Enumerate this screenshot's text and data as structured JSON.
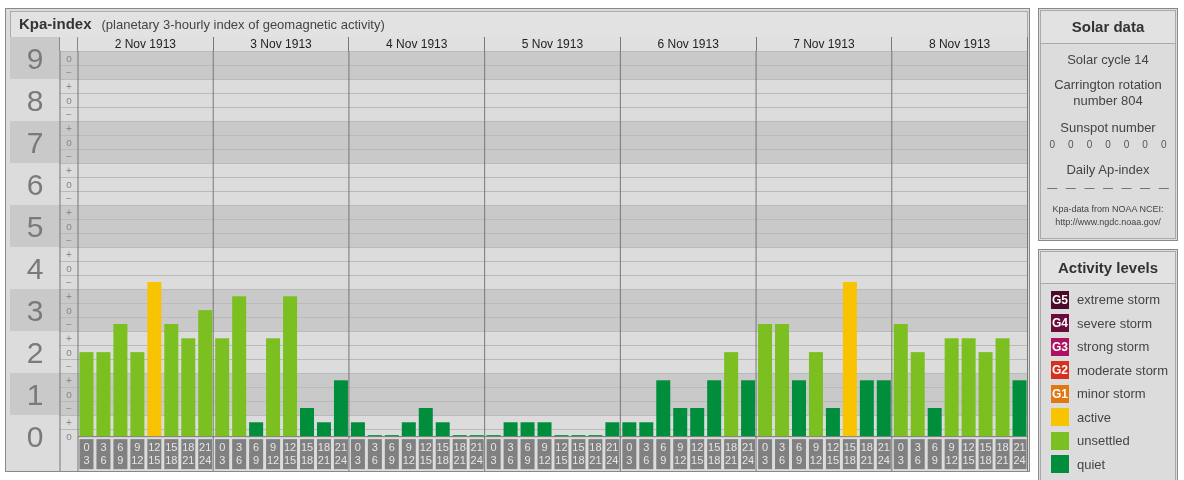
{
  "kpa": {
    "title": "Kpa-index",
    "subtitle": "(planetary 3-hourly index of geomagnetic activity)",
    "days": [
      "2 Nov 1913",
      "3 Nov 1913",
      "4 Nov 1913",
      "5 Nov 1913",
      "6 Nov 1913",
      "7 Nov 1913",
      "8 Nov 1913"
    ],
    "minor_labels": [
      "o",
      "−",
      "+",
      "o",
      "−",
      "+",
      "o",
      "−",
      "+",
      "o",
      "−",
      "+",
      "o",
      "−",
      "+",
      "o",
      "−",
      "+",
      "o",
      "−",
      "+",
      "o",
      "−",
      "+",
      "o",
      "−",
      "+",
      "o"
    ],
    "chart_data": {
      "type": "bar",
      "stacked": true,
      "grid": true,
      "ylim": [
        0,
        9.17
      ],
      "yticks": [
        {
          "value": 0,
          "label": "0"
        },
        {
          "value": 1,
          "label": "1"
        },
        {
          "value": 2,
          "label": "2"
        },
        {
          "value": 3,
          "label": "3"
        },
        {
          "value": 4,
          "label": "4"
        },
        {
          "value": 5,
          "label": "5"
        },
        {
          "value": 6,
          "label": "6"
        },
        {
          "value": 7,
          "label": "7"
        },
        {
          "value": 8,
          "label": "8"
        },
        {
          "value": 9,
          "label": "9"
        }
      ],
      "categories": [
        "0 3",
        "3 6",
        "6 9",
        "9 12",
        "12 15",
        "15 18",
        "18 21",
        "21 24",
        "0 3",
        "3 6",
        "6 9",
        "9 12",
        "12 15",
        "15 18",
        "18 21",
        "21 24",
        "0 3",
        "3 6",
        "6 9",
        "9 12",
        "12 15",
        "15 18",
        "18 21",
        "21 24",
        "0 3",
        "3 6",
        "6 9",
        "9 12",
        "12 15",
        "15 18",
        "18 21",
        "21 24",
        "0 3",
        "3 6",
        "6 9",
        "9 12",
        "12 15",
        "15 18",
        "18 21",
        "21 24",
        "0 3",
        "3 6",
        "6 9",
        "9 12",
        "12 15",
        "15 18",
        "18 21",
        "21 24",
        "0 3",
        "3 6",
        "6 9",
        "9 12",
        "12 15",
        "15 18",
        "18 21",
        "21 24"
      ],
      "series": [
        {
          "name": "quiet",
          "color": "#008e3d",
          "values": [
            null,
            null,
            null,
            null,
            null,
            null,
            null,
            null,
            null,
            null,
            0.33,
            null,
            null,
            0.67,
            0.33,
            1.33,
            0.33,
            0,
            0,
            0.33,
            0.67,
            0.33,
            0,
            0,
            0,
            0.33,
            0.33,
            0.33,
            0,
            0,
            0,
            0.33,
            0.33,
            0.33,
            1.33,
            0.67,
            0.67,
            1.33,
            null,
            1.33,
            null,
            null,
            1.33,
            null,
            0.67,
            null,
            1.33,
            1.33,
            null,
            null,
            0.67,
            null,
            null,
            null,
            null,
            1.33
          ]
        },
        {
          "name": "unsettled",
          "color": "#7bbf21",
          "values": [
            2,
            2,
            2.67,
            2,
            null,
            2.67,
            2.33,
            3,
            2.33,
            3.33,
            null,
            2.33,
            3.33,
            null,
            null,
            null,
            null,
            null,
            null,
            null,
            null,
            null,
            null,
            null,
            null,
            null,
            null,
            null,
            null,
            null,
            null,
            null,
            null,
            null,
            null,
            null,
            null,
            null,
            2,
            null,
            2.67,
            2.67,
            null,
            2,
            null,
            null,
            null,
            null,
            2.67,
            2,
            null,
            2.33,
            2.33,
            2,
            2.33,
            null
          ]
        },
        {
          "name": "active",
          "color": "#f8c300",
          "values": [
            null,
            null,
            null,
            null,
            3.67,
            null,
            null,
            null,
            null,
            null,
            null,
            null,
            null,
            null,
            null,
            null,
            null,
            null,
            null,
            null,
            null,
            null,
            null,
            null,
            null,
            null,
            null,
            null,
            null,
            null,
            null,
            null,
            null,
            null,
            null,
            null,
            null,
            null,
            null,
            null,
            null,
            null,
            null,
            null,
            null,
            3.67,
            null,
            null,
            null,
            null,
            null,
            null,
            null,
            null,
            null,
            null
          ]
        }
      ]
    }
  },
  "solar": {
    "title": "Solar data",
    "cycle": "Solar cycle 14",
    "rotation": "Carrington rotation number 804",
    "sunspot_label": "Sunspot number",
    "sunspots": [
      "0",
      "0",
      "0",
      "0",
      "0",
      "0",
      "0"
    ],
    "ap_label": "Daily Ap-index",
    "ap": [
      "—",
      "—",
      "—",
      "—",
      "—",
      "—",
      "—"
    ],
    "source": "Kpa-data from NOAA NCEI:",
    "source_url": "http://www.ngdc.noaa.gov/"
  },
  "activity": {
    "title": "Activity levels",
    "items": [
      {
        "badge": "G5",
        "label": "extreme storm",
        "color": "#4a0a28"
      },
      {
        "badge": "G4",
        "label": "severe storm",
        "color": "#6c0c3c"
      },
      {
        "badge": "G3",
        "label": "strong storm",
        "color": "#b01060"
      },
      {
        "badge": "G2",
        "label": "moderate storm",
        "color": "#d8301e"
      },
      {
        "badge": "G1",
        "label": "minor storm",
        "color": "#e27812"
      }
    ]
  }
}
